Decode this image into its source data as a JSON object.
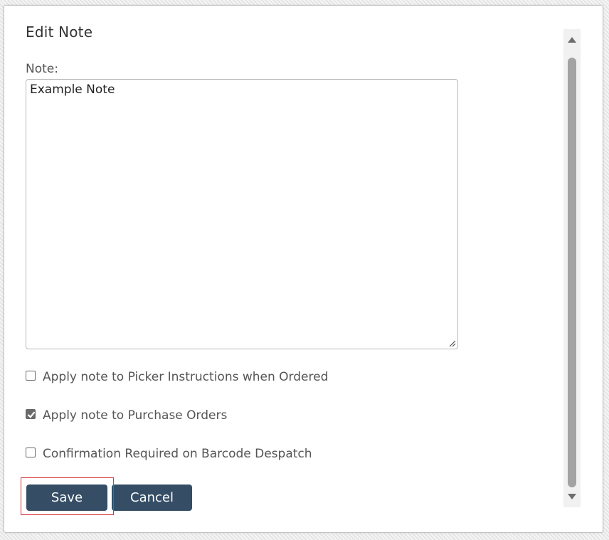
{
  "dialog": {
    "title": "Edit Note",
    "note_label": "Note:",
    "note_value": "Example Note",
    "options": [
      {
        "label": "Apply note to Picker Instructions when Ordered",
        "checked": false
      },
      {
        "label": "Apply note to Purchase Orders",
        "checked": true
      },
      {
        "label": "Confirmation Required on Barcode Despatch",
        "checked": false
      }
    ],
    "save_label": "Save",
    "cancel_label": "Cancel"
  },
  "colors": {
    "button_bg": "#354e66",
    "highlight_border": "#d9343a",
    "scroll_thumb": "#a3a3a3"
  },
  "icons": {
    "checkmark": "checkmark-icon",
    "scroll_up": "triangle-up-icon",
    "scroll_down": "triangle-down-icon",
    "resize": "resize-grip-icon"
  }
}
